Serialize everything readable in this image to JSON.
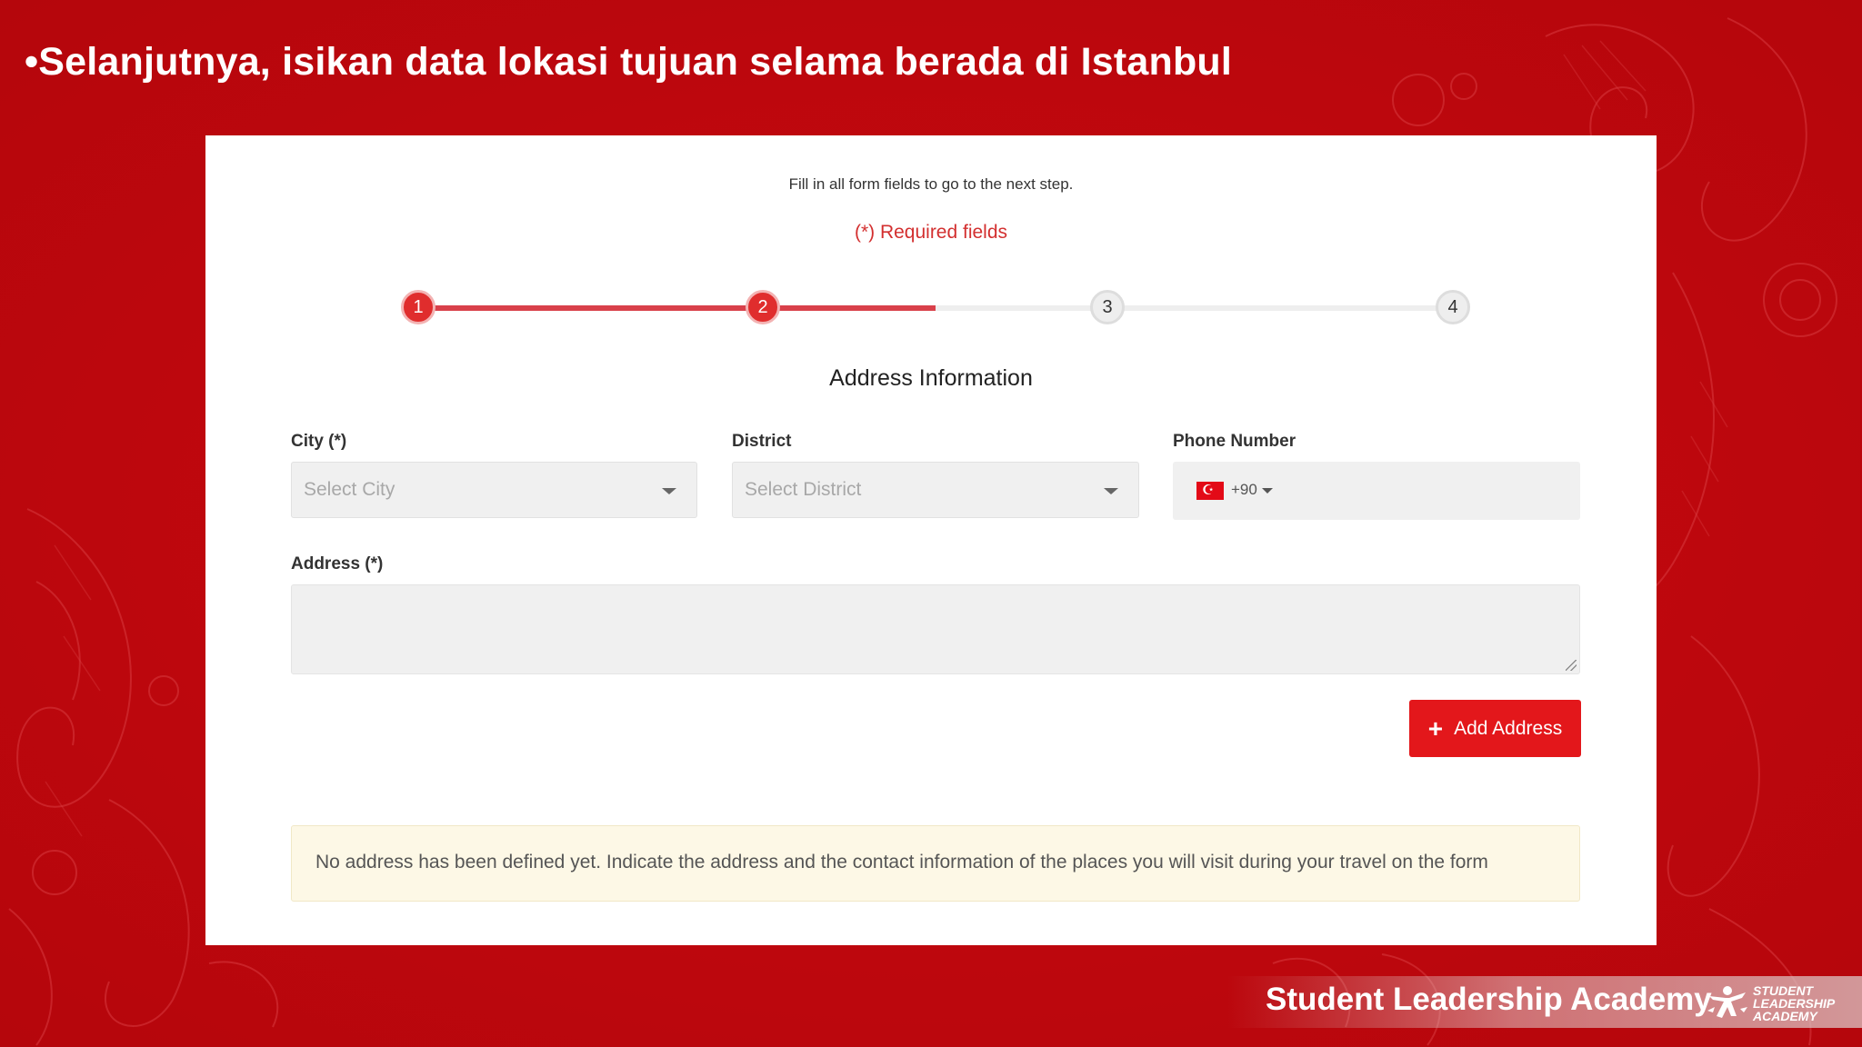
{
  "slide": {
    "title": "•Selanjutnya, isikan data lokasi tujuan selama berada di Istanbul"
  },
  "form": {
    "hint": "Fill in all form fields to go to the next step.",
    "required_note": "(*) Required fields",
    "steps": [
      {
        "label": "1",
        "state": "completed"
      },
      {
        "label": "2",
        "state": "current"
      },
      {
        "label": "3",
        "state": "pending"
      },
      {
        "label": "4",
        "state": "pending"
      }
    ],
    "progress_fraction": 0.5,
    "section_title": "Address Information",
    "city": {
      "label": "City (*)",
      "placeholder": "Select City"
    },
    "district": {
      "label": "District",
      "placeholder": "Select District"
    },
    "phone": {
      "label": "Phone Number",
      "country_flag": "turkey-flag-icon",
      "dial_code": "+90"
    },
    "address": {
      "label": "Address (*)",
      "value": ""
    },
    "add_button": {
      "label": "Add Address",
      "icon": "plus-icon"
    },
    "notice": "No address has been defined yet. Indicate the address and the contact information of the places you will visit during your travel on the form"
  },
  "footer": {
    "brand": "Student Leadership Academy",
    "logo_text": "STUDENT\nLEADERSHIP\nACADEMY"
  },
  "colors": {
    "slide_background": "#c4070f",
    "accent_red": "#e3171b",
    "progress_red": "#d9404a",
    "notice_background": "#fdf8e6"
  }
}
